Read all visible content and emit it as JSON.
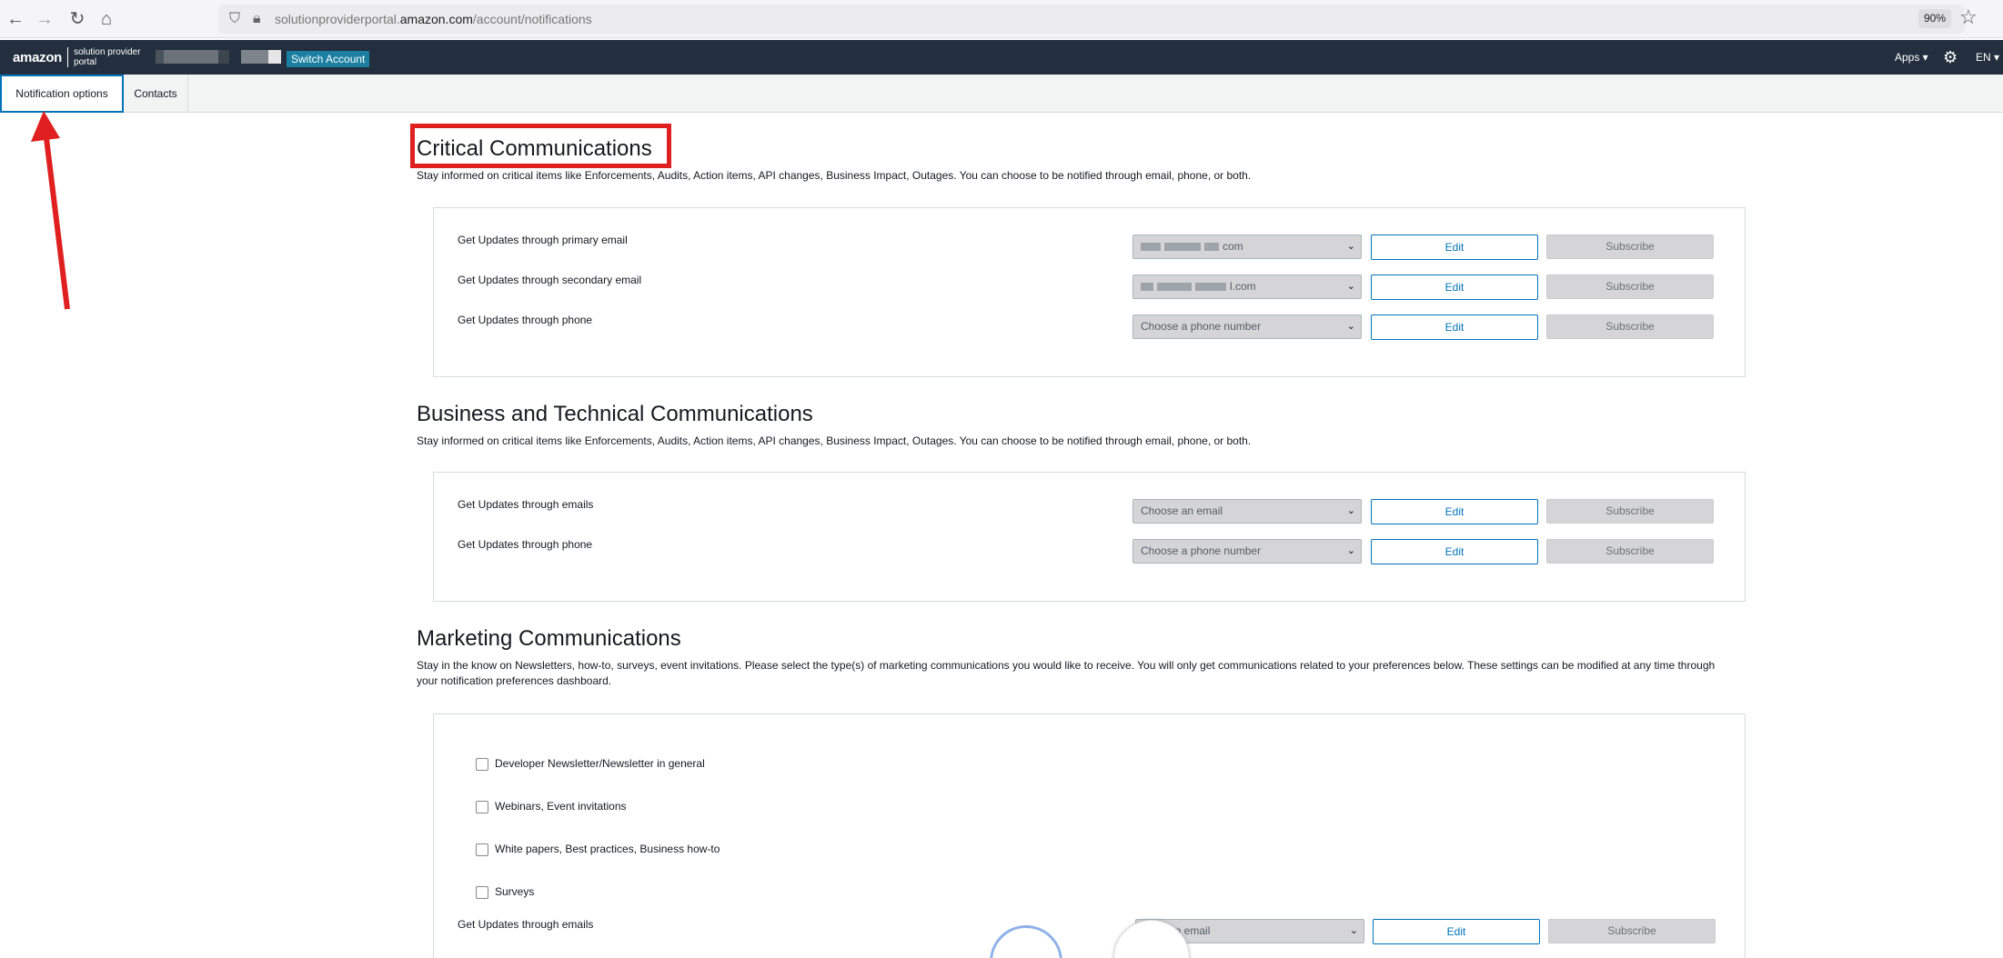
{
  "browser": {
    "url_prefix": "solutionproviderportal.",
    "url_host": "amazon.com",
    "url_path": "/account/notifications",
    "zoom": "90%"
  },
  "header": {
    "logo_word": "amazon",
    "logo_sub": "solution provider portal",
    "switch_account_label": "Switch Account",
    "apps_label": "Apps ▾",
    "lang_label": "EN ▾"
  },
  "tabs": [
    {
      "label": "Notification options",
      "active": true
    },
    {
      "label": "Contacts",
      "active": false
    }
  ],
  "critical": {
    "title": "Critical Communications",
    "description": "Stay informed on critical items like Enforcements, Audits, Action items, API changes, Business Impact, Outages. You can choose to be notified through email, phone, or both.",
    "rows": [
      {
        "label": "Get Updates through primary email",
        "select_value": "com",
        "edit": "Edit",
        "subscribe": "Subscribe"
      },
      {
        "label": "Get Updates through secondary email",
        "select_value": "l.com",
        "edit": "Edit",
        "subscribe": "Subscribe"
      },
      {
        "label": "Get Updates through phone",
        "select_value": "Choose a phone number",
        "edit": "Edit",
        "subscribe": "Subscribe"
      }
    ]
  },
  "business": {
    "title": "Business and Technical Communications",
    "description": "Stay informed on critical items like Enforcements, Audits, Action items, API changes, Business Impact, Outages. You can choose to be notified through email, phone, or both.",
    "rows": [
      {
        "label": "Get Updates through emails",
        "select_value": "Choose an email",
        "edit": "Edit",
        "subscribe": "Subscribe"
      },
      {
        "label": "Get Updates through phone",
        "select_value": "Choose a phone number",
        "edit": "Edit",
        "subscribe": "Subscribe"
      }
    ]
  },
  "marketing": {
    "title": "Marketing Communications",
    "description_line1": "Stay in the know on Newsletters, how-to, surveys, event invitations. Please select the type(s) of marketing communications you would like to receive. You will only get communications related to your preferences below. These settings can be modified at any time through",
    "description_line2": "your notification preferences dashboard.",
    "checkboxes": [
      {
        "label": "Developer Newsletter/Newsletter in general"
      },
      {
        "label": "Webinars, Event invitations"
      },
      {
        "label": "White papers, Best practices, Business how-to"
      },
      {
        "label": "Surveys"
      }
    ],
    "row": {
      "label": "Get Updates through emails",
      "select_value": "an email",
      "edit": "Edit",
      "subscribe": "Subscribe"
    }
  },
  "colors": {
    "nav_bg": "#232f3e",
    "accent": "#0073bb",
    "switch_btn": "#1a7fa0",
    "annotation_red": "#e02020"
  },
  "icons": [
    "back-arrow-icon",
    "forward-arrow-icon",
    "reload-icon",
    "home-icon",
    "shield-icon",
    "lock-icon",
    "star-icon",
    "gear-icon",
    "chevron-down-icon"
  ]
}
